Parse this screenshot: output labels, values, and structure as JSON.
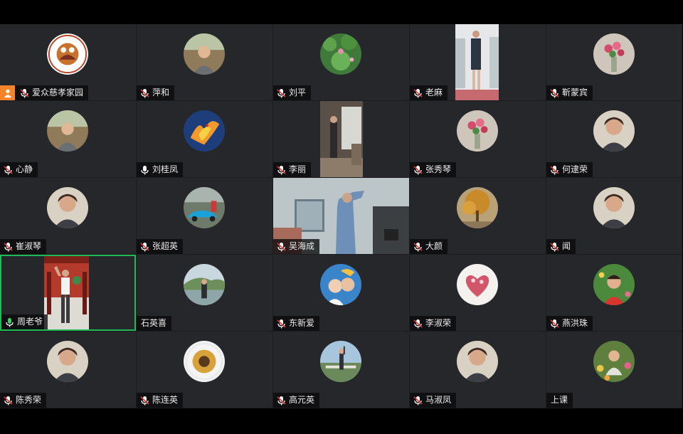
{
  "meeting": {
    "participants": [
      {
        "name": "爱众慈孝家园",
        "mic": "muted",
        "host": true,
        "avatar": "logo-avatar"
      },
      {
        "name": "萍和",
        "mic": "muted",
        "avatar": "photo-avatar"
      },
      {
        "name": "刘平",
        "mic": "muted",
        "avatar": "lotus-photo-avatar"
      },
      {
        "name": "老麻",
        "mic": "muted",
        "video": true
      },
      {
        "name": "靳蒙宾",
        "mic": "muted",
        "avatar": "flowers-photo-avatar"
      },
      {
        "name": "心静",
        "mic": "muted",
        "avatar": "photo-avatar"
      },
      {
        "name": "刘桂凤",
        "mic": "on",
        "avatar": "phoenix-avatar"
      },
      {
        "name": "李丽",
        "mic": "muted",
        "video": true
      },
      {
        "name": "张秀琴",
        "mic": "muted",
        "avatar": "flowers-photo-avatar"
      },
      {
        "name": "何逮荣",
        "mic": "muted",
        "avatar": "portrait-avatar"
      },
      {
        "name": "崔淑琴",
        "mic": "muted",
        "avatar": "portrait-avatar"
      },
      {
        "name": "张超英",
        "mic": "muted",
        "avatar": "car-photo-avatar"
      },
      {
        "name": "吴海成",
        "mic": "muted",
        "video": true
      },
      {
        "name": "大颜",
        "mic": "muted",
        "avatar": "autumn-tree-avatar"
      },
      {
        "name": "闻",
        "mic": "muted",
        "avatar": "portrait-avatar"
      },
      {
        "name": "周老爷",
        "mic": "speaking",
        "video": true,
        "active": true
      },
      {
        "name": "石英喜",
        "mic": "none",
        "avatar": "lake-photo-avatar"
      },
      {
        "name": "东新爱",
        "mic": "muted",
        "avatar": "family-photo-avatar"
      },
      {
        "name": "李淑荣",
        "mic": "muted",
        "avatar": "heart-photo-avatar"
      },
      {
        "name": "燕洪珠",
        "mic": "muted",
        "avatar": "flowers-portrait-avatar"
      },
      {
        "name": "陈秀荣",
        "mic": "muted",
        "avatar": "portrait-avatar"
      },
      {
        "name": "陈连英",
        "mic": "muted",
        "avatar": "sunflower-avatar"
      },
      {
        "name": "高元英",
        "mic": "muted",
        "avatar": "outdoor-photo-avatar"
      },
      {
        "name": "马淑凤",
        "mic": "muted",
        "avatar": "portrait-avatar"
      },
      {
        "name": "上课",
        "mic": "none",
        "avatar": "garden-photo-avatar"
      }
    ]
  },
  "colors": {
    "tile_bg": "#25272b",
    "active_border": "#1fb956",
    "host_badge": "#f4832a",
    "muted_mic": "#ffffff",
    "speaking_mic": "#3fd06a"
  }
}
